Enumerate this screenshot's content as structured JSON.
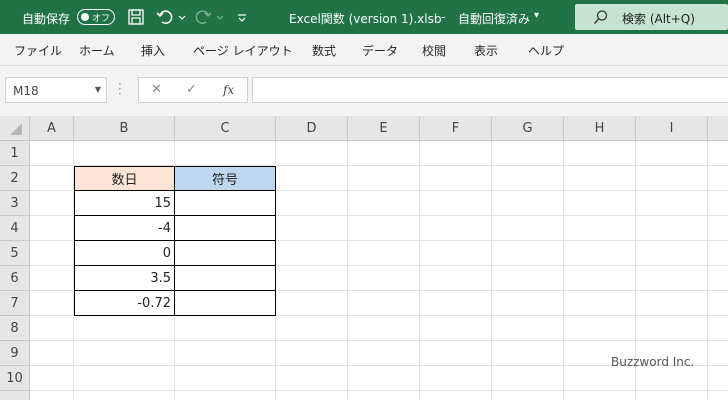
{
  "titlebar": {
    "autosave_label": "自動保存",
    "autosave_state": "オフ",
    "document_title": "Excel関数 (version 1).xlsb",
    "separator": "-",
    "save_status": "自動回復済み",
    "search_placeholder": "検索 (Alt+Q)"
  },
  "ribbon": {
    "tabs": [
      "ファイル",
      "ホーム",
      "挿入",
      "ページ レイアウト",
      "数式",
      "データ",
      "校閲",
      "表示",
      "ヘルプ"
    ]
  },
  "formula_bar": {
    "name_box": "M18",
    "fx_label": "fx",
    "formula": ""
  },
  "sheet": {
    "columns": [
      "A",
      "B",
      "C",
      "D",
      "E",
      "F",
      "G",
      "H",
      "I"
    ],
    "rows": [
      "1",
      "2",
      "3",
      "4",
      "5",
      "6",
      "7",
      "8",
      "9",
      "10"
    ],
    "header_number": "数日",
    "header_sign": "符号",
    "values": [
      "15",
      "-4",
      "0",
      "3.5",
      "-0.72"
    ]
  },
  "watermark": "Buzzword Inc.",
  "colors": {
    "titlebar": "#217346",
    "header_number_fill": "#fce4d6",
    "header_sign_fill": "#bdd7ee"
  }
}
